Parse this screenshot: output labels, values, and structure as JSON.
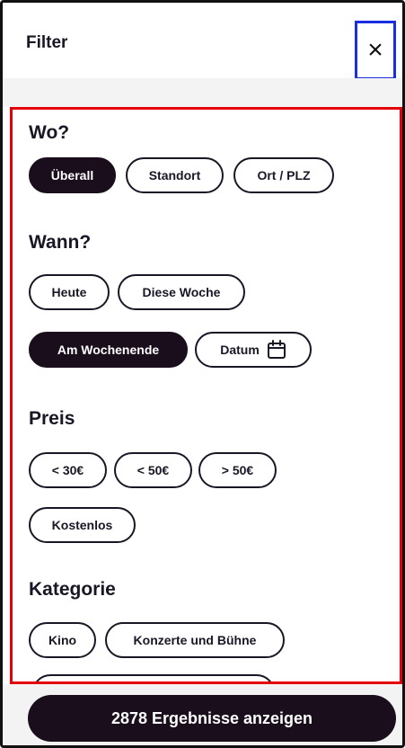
{
  "header": {
    "title": "Filter",
    "close_icon": "close-icon",
    "close_glyph": "×"
  },
  "sections": {
    "where": {
      "title": "Wo?",
      "chips": [
        "Überall",
        "Standort",
        "Ort / PLZ"
      ],
      "selected": "Überall"
    },
    "when": {
      "title": "Wann?",
      "chips": [
        "Heute",
        "Diese Woche",
        "Am Wochenende",
        "Datum"
      ],
      "selected": "Am Wochenende",
      "date_icon": "calendar-icon"
    },
    "price": {
      "title": "Preis",
      "chips": [
        "< 30€",
        "< 50€",
        "> 50€",
        "Kostenlos"
      ]
    },
    "category": {
      "title": "Kategorie",
      "chips": [
        "Kino",
        "Konzerte und Bühne"
      ]
    }
  },
  "footer": {
    "button_label": "2878 Ergebnisse anzeigen"
  },
  "colors": {
    "active_chip": "#1a0d1c",
    "highlight_red": "#e3000b",
    "highlight_blue": "#1a2fe0"
  }
}
